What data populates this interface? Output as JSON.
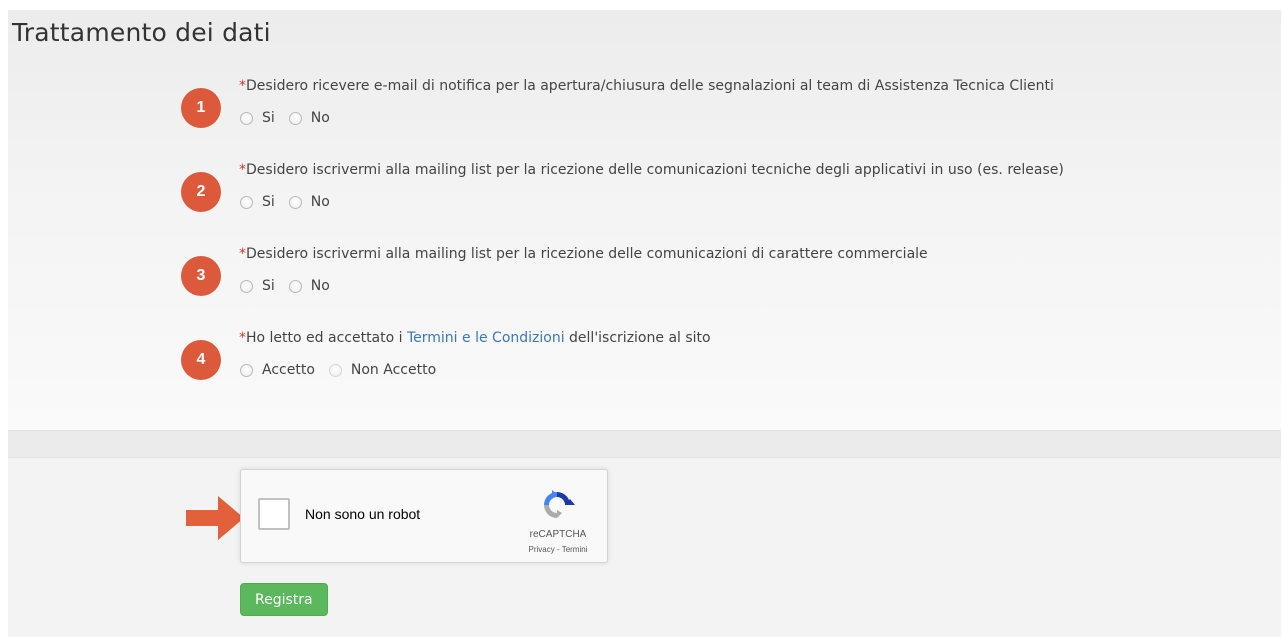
{
  "section": {
    "title": "Trattamento dei dati"
  },
  "questions": [
    {
      "number": "1",
      "required_mark": "*",
      "text": "Desidero ricevere e-mail di notifica per la apertura/chiusura delle segnalazioni al team di Assistenza Tecnica Clienti",
      "options": [
        "Si",
        "No"
      ]
    },
    {
      "number": "2",
      "required_mark": "*",
      "text": "Desidero iscrivermi alla mailing list per la ricezione delle comunicazioni tecniche degli applicativi in uso (es. release)",
      "options": [
        "Si",
        "No"
      ]
    },
    {
      "number": "3",
      "required_mark": "*",
      "text": "Desidero iscrivermi alla mailing list per la ricezione delle comunicazioni di carattere commerciale",
      "options": [
        "Si",
        "No"
      ]
    },
    {
      "number": "4",
      "required_mark": "*",
      "text_before": "Ho letto ed accettato i ",
      "link_text": "Termini e le Condizioni",
      "text_after": " dell'iscrizione al sito",
      "options": [
        "Accetto",
        "Non Accetto"
      ]
    }
  ],
  "recaptcha": {
    "label": "Non sono un robot",
    "brand": "reCAPTCHA",
    "terms": "Privacy - Termini"
  },
  "submit": {
    "label": "Registra"
  },
  "colors": {
    "badge": "#dc5a3b",
    "required": "#e0342a",
    "link": "#3a78b8",
    "button": "#5cb85c",
    "arrow": "#e2613a"
  },
  "icons": {
    "badge": "numbered-circle",
    "pointer": "arrow-right-icon",
    "recaptcha_logo": "recaptcha-icon"
  }
}
